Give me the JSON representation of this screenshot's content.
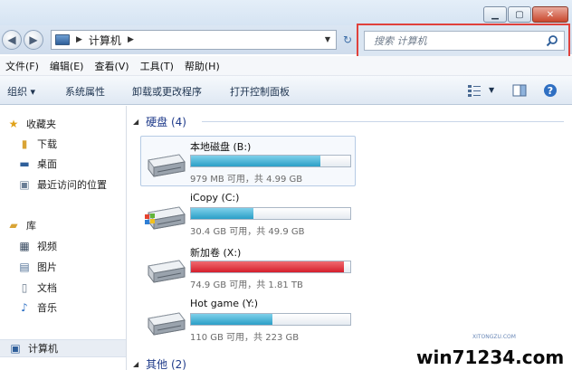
{
  "window": {
    "controls": [
      "minimize",
      "maximize",
      "close"
    ]
  },
  "address": {
    "breadcrumb": [
      "计算机"
    ],
    "icon": "computer-icon"
  },
  "search": {
    "placeholder": "搜索 计算机",
    "icon": "search-icon",
    "highlight_color": "#e0413c"
  },
  "menu": {
    "items": [
      "文件(F)",
      "编辑(E)",
      "查看(V)",
      "工具(T)",
      "帮助(H)"
    ]
  },
  "commands": {
    "organize": "组织 ▾",
    "system_properties": "系统属性",
    "uninstall": "卸载或更改程序",
    "control_panel": "打开控制面板"
  },
  "nav": {
    "favorites": "收藏夹",
    "favorites_items": [
      "下载",
      "桌面",
      "最近访问的位置"
    ],
    "libraries": "库",
    "library_items": [
      "视频",
      "图片",
      "文档",
      "音乐"
    ],
    "computer": "计算机"
  },
  "content": {
    "group_title": "硬盘 (4)",
    "other_group_title": "其他 (2)",
    "drives": [
      {
        "name": "本地磁盘 (B:)",
        "info": "979 MB 可用，共 4.99 GB",
        "used_fraction": 0.81,
        "color": "#2a9fc7"
      },
      {
        "name": "iCopy (C:)",
        "info": "30.4 GB 可用，共 49.9 GB",
        "used_fraction": 0.39,
        "color": "#2a9fc7"
      },
      {
        "name": "新加卷 (X:)",
        "info": "74.9 GB 可用，共 1.81 TB",
        "used_fraction": 0.96,
        "color": "#d51f2c"
      },
      {
        "name": "Hot game (Y:)",
        "info": "110 GB 可用，共 223 GB",
        "used_fraction": 0.51,
        "color": "#2a9fc7"
      }
    ]
  },
  "watermark": {
    "text": "win71234.com",
    "sub": "XITONGZU.COM"
  }
}
